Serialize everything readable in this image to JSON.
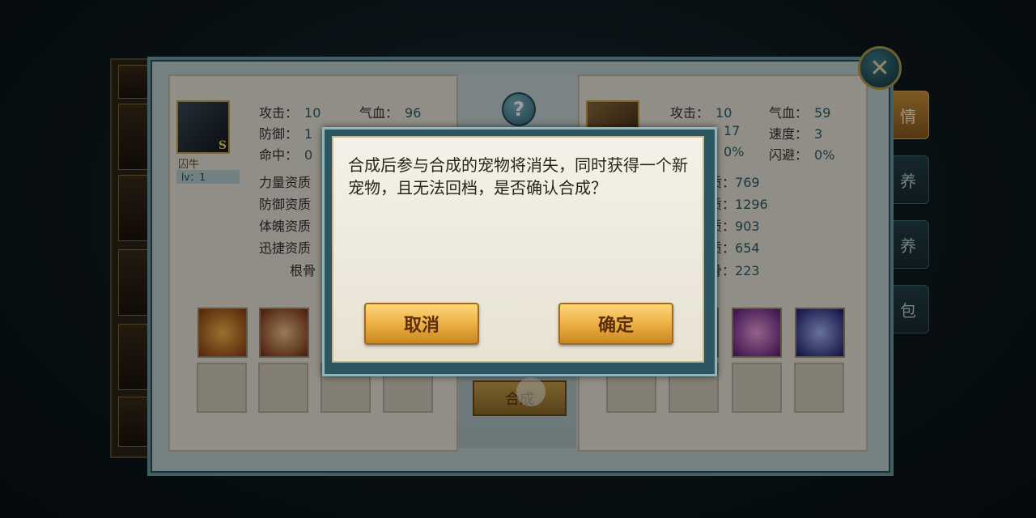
{
  "left_pet": {
    "name": "囚牛",
    "level": "lv：1",
    "grade": "S",
    "stats": [
      {
        "label": "攻击：",
        "value": "10"
      },
      {
        "label": "气血：",
        "value": "96"
      },
      {
        "label": "防御：",
        "value": "1"
      },
      {
        "label": "命中：",
        "value": "0"
      }
    ],
    "aptitudes": [
      "力量资质",
      "防御资质",
      "体魄资质",
      "迅捷资质",
      "根骨"
    ]
  },
  "right_pet": {
    "stats": [
      {
        "label": "攻击：",
        "value": "10"
      },
      {
        "label": "气血：",
        "value": "59"
      },
      {
        "label": "",
        "value": "17"
      },
      {
        "label": "速度：",
        "value": "3"
      },
      {
        "label": "",
        "value": "0%"
      },
      {
        "label": "闪避：",
        "value": "0%"
      }
    ],
    "aptitudes": [
      {
        "label": "质：",
        "value": "769"
      },
      {
        "label": "质：",
        "value": "1296"
      },
      {
        "label": "质：",
        "value": "903"
      },
      {
        "label": "质：",
        "value": "654"
      },
      {
        "label": "骨：",
        "value": "223"
      }
    ]
  },
  "side_tabs": [
    "情",
    "养",
    "养",
    "包"
  ],
  "help_label": "?",
  "close_label": "✕",
  "combine_label": "合成",
  "dialog": {
    "message": "合成后参与合成的宠物将消失，同时获得一个新宠物，且无法回档，是否确认合成？",
    "cancel_label": "取消",
    "confirm_label": "确定"
  }
}
